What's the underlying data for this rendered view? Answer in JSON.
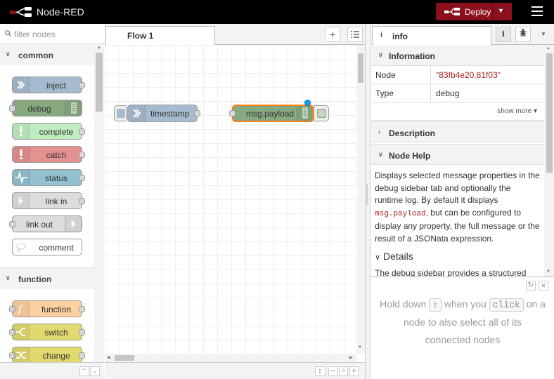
{
  "header": {
    "app_name": "Node-RED",
    "deploy_label": "Deploy"
  },
  "palette": {
    "filter_placeholder": "filter nodes",
    "categories": [
      {
        "name": "common",
        "nodes": [
          {
            "label": "inject",
            "color": "#a6bbcf"
          },
          {
            "label": "debug",
            "color": "#87a980"
          },
          {
            "label": "complete",
            "color": "#c0edc0"
          },
          {
            "label": "catch",
            "color": "#e49191"
          },
          {
            "label": "status",
            "color": "#94c1d0"
          },
          {
            "label": "link in",
            "color": "#dddddd"
          },
          {
            "label": "link out",
            "color": "#dddddd"
          },
          {
            "label": "comment",
            "color": "#ffffff"
          }
        ]
      },
      {
        "name": "function",
        "nodes": [
          {
            "label": "function",
            "color": "#fdd0a2"
          },
          {
            "label": "switch",
            "color": "#e2d96e"
          },
          {
            "label": "change",
            "color": "#e2d96e"
          }
        ]
      }
    ]
  },
  "workspace": {
    "tab": "Flow 1",
    "nodes": [
      {
        "label": "timestamp",
        "color": "#a6bbcf"
      },
      {
        "label": "msg.payload",
        "color": "#87a980",
        "selected": true
      }
    ]
  },
  "sidebar": {
    "tab": "info",
    "information_title": "Information",
    "props": [
      {
        "key": "Node",
        "value": "\"83fb4e20.81f03\""
      },
      {
        "key": "Type",
        "value": "debug"
      }
    ],
    "show_more": "show more",
    "description_title": "Description",
    "node_help_title": "Node Help",
    "help_pre": "Displays selected message properties in the debug sidebar tab and optionally the runtime log. By default it displays ",
    "help_code": "msg.payload",
    "help_post": ", but can be configured to display any property, the full message or the result of a JSONata expression.",
    "details_title": "Details",
    "details_text": "The debug sidebar provides a structured view",
    "tip": {
      "pre": "Hold down ",
      "key1": "⇧",
      "mid": " when you ",
      "key2": "click",
      "post": " on a node to also select all of its connected nodes"
    }
  }
}
